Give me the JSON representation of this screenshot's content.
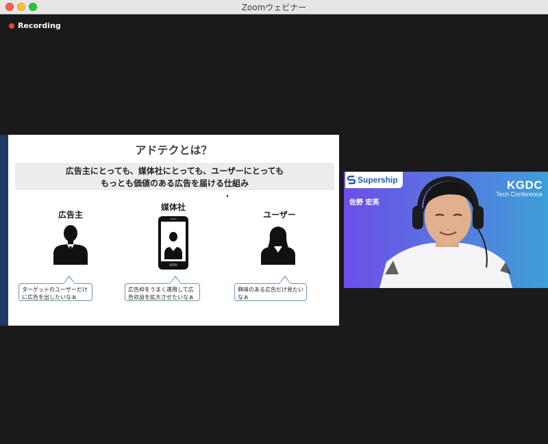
{
  "window": {
    "title": "Zoomウェビナー"
  },
  "recording": {
    "label": "Recording"
  },
  "slide": {
    "title": "アドテクとは？",
    "banner_line1": "広告主にとっても、媒体社にとっても、ユーザーにとっても",
    "banner_line2": "もっとも価値のある広告を届ける仕組み",
    "actors": [
      {
        "label": "広告主",
        "bubble_line1": "ターゲットのユーザーだけ",
        "bubble_line2": "に広告を出したいなぁ"
      },
      {
        "label": "媒体社",
        "bubble_line1": "広告枠をうまく運用して広",
        "bubble_line2": "告収益を拡大させたいなぁ"
      },
      {
        "label": "ユーザー",
        "bubble_line1": "興味のある広告だけ見たい",
        "bubble_line2": "なぁ"
      }
    ],
    "accent_color": "#1f3864",
    "bubble_border_color": "#6c8ebf"
  },
  "video": {
    "brand": "Supership",
    "speaker_name": "佐野 宏英",
    "conference_name": "KGDC",
    "conference_sub": "Tech Conference",
    "background_gradient": [
      "#6d4ee8",
      "#3f9fd8"
    ]
  }
}
